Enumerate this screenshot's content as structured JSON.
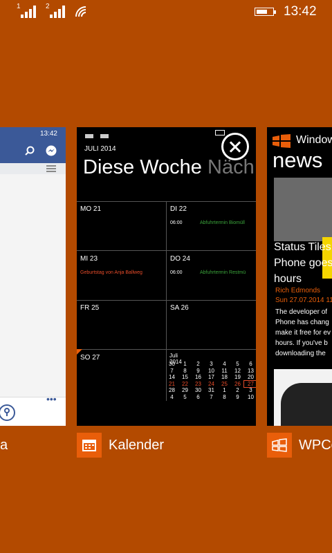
{
  "status_bar": {
    "sim1": "1",
    "sim2": "2",
    "time": "13:42"
  },
  "apps": [
    {
      "label": "a",
      "icon": "facebook-app"
    },
    {
      "label": "Kalender",
      "icon": "calendar-icon"
    },
    {
      "label": "WPCe",
      "icon": "windows-logo-icon"
    }
  ],
  "facebook_card": {
    "time": "13:42"
  },
  "calendar_card": {
    "month": "JULI 2014",
    "title": "Diese Woche",
    "title_next": "Näch",
    "days": [
      {
        "label": "MO 21"
      },
      {
        "label": "DI 22",
        "event_time": "06:00",
        "event": "Abfuhrtermin Biomüll"
      },
      {
        "label": "MI 23",
        "event": "Geburtstag von Anja Ballweg"
      },
      {
        "label": "DO 24",
        "event_time": "06:00",
        "event": "Abfuhrtermin Restmü"
      },
      {
        "label": "FR 25"
      },
      {
        "label": "SA 26"
      },
      {
        "label": "SO 27"
      }
    ],
    "mini_calendar": {
      "title": "Juli 2014",
      "rows": [
        [
          "30",
          "1",
          "2",
          "3",
          "4",
          "5",
          "6"
        ],
        [
          "7",
          "8",
          "9",
          "10",
          "11",
          "12",
          "13"
        ],
        [
          "14",
          "15",
          "16",
          "17",
          "18",
          "19",
          "20"
        ],
        [
          "21",
          "22",
          "23",
          "24",
          "25",
          "26",
          "27"
        ],
        [
          "28",
          "29",
          "30",
          "31",
          "1",
          "2",
          "3"
        ],
        [
          "4",
          "5",
          "6",
          "7",
          "8",
          "9",
          "10"
        ]
      ]
    }
  },
  "news_card": {
    "header": "Windows",
    "title": "news",
    "headline_lines": [
      "Status Tiles",
      "Phone goes",
      "hours"
    ],
    "author": "Rich Edmonds",
    "date": "Sun 27.07.2014 11",
    "body_lines": [
      "The developer of",
      "Phone has chang",
      "make it free for ev",
      "hours. If you've b",
      "downloading the"
    ]
  },
  "colors": {
    "background": "#B34A00",
    "accent": "#E95E0A",
    "event_green": "#3BA43B",
    "event_red": "#E84C2A"
  }
}
